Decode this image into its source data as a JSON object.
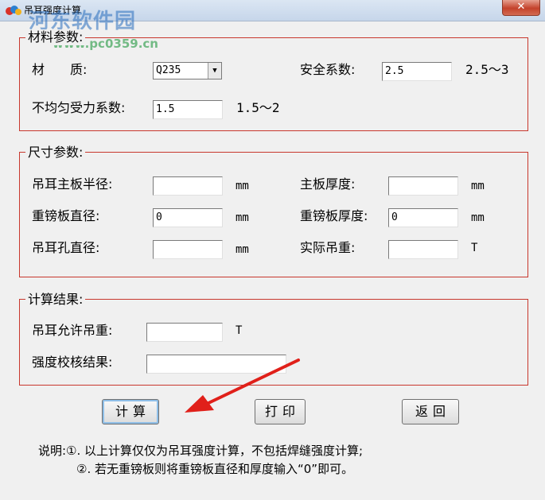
{
  "window": {
    "title": "吊耳强度计算",
    "close_glyph": "✕"
  },
  "watermark": {
    "brand": "河东软件园",
    "url": "www.pc0359.cn"
  },
  "material_group": {
    "title": "材料参数:",
    "material_label": "材　　质:",
    "material_value": "Q235",
    "safety_label": "安全系数:",
    "safety_value": "2.5",
    "safety_range": "2.5～3",
    "uneven_label": "不均匀受力系数:",
    "uneven_value": "1.5",
    "uneven_range": "1.5～2"
  },
  "size_group": {
    "title": "尺寸参数:",
    "main_radius_label": "吊耳主板半径:",
    "main_radius_value": "",
    "main_radius_unit": "mm",
    "main_thickness_label": "主板厚度:",
    "main_thickness_value": "",
    "main_thickness_unit": "mm",
    "pad_diameter_label": "重镑板直径:",
    "pad_diameter_value": "0",
    "pad_diameter_unit": "mm",
    "pad_thickness_label": "重镑板厚度:",
    "pad_thickness_value": "0",
    "pad_thickness_unit": "mm",
    "hole_diameter_label": "吊耳孔直径:",
    "hole_diameter_value": "",
    "hole_diameter_unit": "mm",
    "actual_weight_label": "实际吊重:",
    "actual_weight_value": "",
    "actual_weight_unit": "T"
  },
  "result_group": {
    "title": "计算结果:",
    "allowed_label": "吊耳允许吊重:",
    "allowed_value": "",
    "allowed_unit": "T",
    "check_label": "强度校核结果:",
    "check_value": ""
  },
  "buttons": {
    "calculate": "计算",
    "print": "打印",
    "back": "返回"
  },
  "notes": {
    "line1": "说明:①. 以上计算仅仅为吊耳强度计算，不包括焊缝强度计算;",
    "line2": "②. 若无重镑板则将重镑板直径和厚度输入“0”即可。"
  },
  "colors": {
    "group_border": "#c8372d",
    "annotation_arrow": "#e0201a",
    "focus_ring": "#8fbfe8"
  }
}
